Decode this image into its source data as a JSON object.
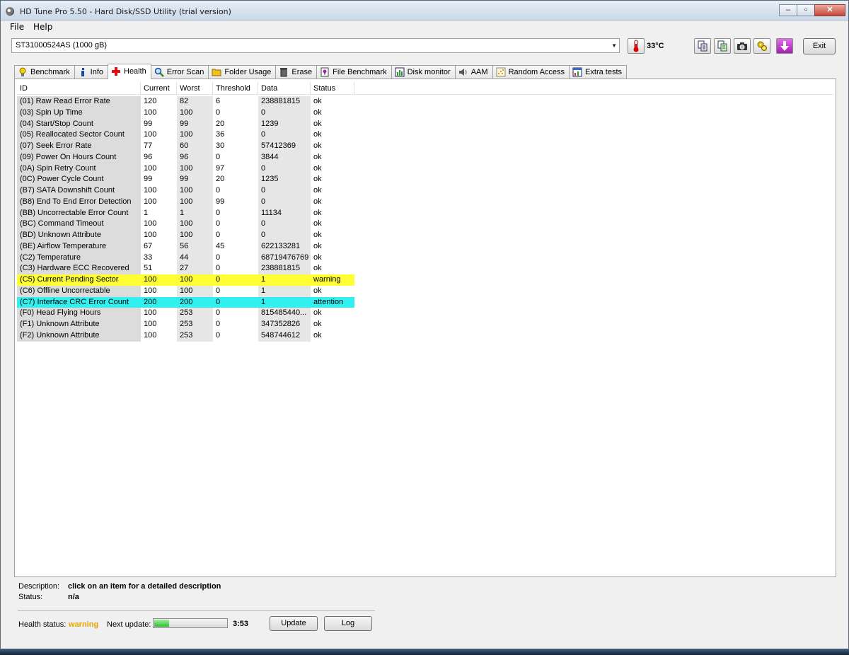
{
  "window": {
    "title": "HD Tune Pro 5.50 - Hard Disk/SSD Utility (trial version)"
  },
  "menu": {
    "file": "File",
    "help": "Help"
  },
  "toolbar": {
    "drive": "ST31000524AS (1000 gB)",
    "temperature": "33°C",
    "exit_label": "Exit",
    "icons": [
      "copy-text-icon",
      "copy-html-icon",
      "screenshot-icon",
      "options-icon",
      "save-icon"
    ]
  },
  "tabs": [
    {
      "label": "Benchmark",
      "icon": "lightbulb-icon"
    },
    {
      "label": "Info",
      "icon": "info-icon"
    },
    {
      "label": "Health",
      "icon": "cross-icon"
    },
    {
      "label": "Error Scan",
      "icon": "magnifier-icon"
    },
    {
      "label": "Folder Usage",
      "icon": "folder-icon"
    },
    {
      "label": "Erase",
      "icon": "trash-icon"
    },
    {
      "label": "File Benchmark",
      "icon": "file-bulb-icon"
    },
    {
      "label": "Disk monitor",
      "icon": "monitor-chart-icon"
    },
    {
      "label": "AAM",
      "icon": "speaker-icon"
    },
    {
      "label": "Random Access",
      "icon": "scatter-icon"
    },
    {
      "label": "Extra tests",
      "icon": "window-chart-icon"
    }
  ],
  "active_tab": "Health",
  "table": {
    "headers": {
      "id": "ID",
      "current": "Current",
      "worst": "Worst",
      "threshold": "Threshold",
      "data": "Data",
      "status": "Status"
    },
    "rows": [
      {
        "id": "(01) Raw Read Error Rate",
        "current": "120",
        "worst": "82",
        "threshold": "6",
        "data": "238881815",
        "status": "ok"
      },
      {
        "id": "(03) Spin Up Time",
        "current": "100",
        "worst": "100",
        "threshold": "0",
        "data": "0",
        "status": "ok"
      },
      {
        "id": "(04) Start/Stop Count",
        "current": "99",
        "worst": "99",
        "threshold": "20",
        "data": "1239",
        "status": "ok"
      },
      {
        "id": "(05) Reallocated Sector Count",
        "current": "100",
        "worst": "100",
        "threshold": "36",
        "data": "0",
        "status": "ok"
      },
      {
        "id": "(07) Seek Error Rate",
        "current": "77",
        "worst": "60",
        "threshold": "30",
        "data": "57412369",
        "status": "ok"
      },
      {
        "id": "(09) Power On Hours Count",
        "current": "96",
        "worst": "96",
        "threshold": "0",
        "data": "3844",
        "status": "ok"
      },
      {
        "id": "(0A) Spin Retry Count",
        "current": "100",
        "worst": "100",
        "threshold": "97",
        "data": "0",
        "status": "ok"
      },
      {
        "id": "(0C) Power Cycle Count",
        "current": "99",
        "worst": "99",
        "threshold": "20",
        "data": "1235",
        "status": "ok"
      },
      {
        "id": "(B7) SATA Downshift Count",
        "current": "100",
        "worst": "100",
        "threshold": "0",
        "data": "0",
        "status": "ok"
      },
      {
        "id": "(B8) End To End Error Detection",
        "current": "100",
        "worst": "100",
        "threshold": "99",
        "data": "0",
        "status": "ok"
      },
      {
        "id": "(BB) Uncorrectable Error Count",
        "current": "1",
        "worst": "1",
        "threshold": "0",
        "data": "11134",
        "status": "ok"
      },
      {
        "id": "(BC) Command Timeout",
        "current": "100",
        "worst": "100",
        "threshold": "0",
        "data": "0",
        "status": "ok"
      },
      {
        "id": "(BD) Unknown Attribute",
        "current": "100",
        "worst": "100",
        "threshold": "0",
        "data": "0",
        "status": "ok"
      },
      {
        "id": "(BE) Airflow Temperature",
        "current": "67",
        "worst": "56",
        "threshold": "45",
        "data": "622133281",
        "status": "ok"
      },
      {
        "id": "(C2) Temperature",
        "current": "33",
        "worst": "44",
        "threshold": "0",
        "data": "68719476769",
        "status": "ok"
      },
      {
        "id": "(C3) Hardware ECC Recovered",
        "current": "51",
        "worst": "27",
        "threshold": "0",
        "data": "238881815",
        "status": "ok"
      },
      {
        "id": "(C5) Current Pending Sector",
        "current": "100",
        "worst": "100",
        "threshold": "0",
        "data": "1",
        "status": "warning",
        "highlight": "#ffff33"
      },
      {
        "id": "(C6) Offline Uncorrectable",
        "current": "100",
        "worst": "100",
        "threshold": "0",
        "data": "1",
        "status": "ok"
      },
      {
        "id": "(C7) Interface CRC Error Count",
        "current": "200",
        "worst": "200",
        "threshold": "0",
        "data": "1",
        "status": "attention",
        "highlight": "#33f0f0"
      },
      {
        "id": "(F0) Head Flying Hours",
        "current": "100",
        "worst": "253",
        "threshold": "0",
        "data": "815485440...",
        "status": "ok"
      },
      {
        "id": "(F1) Unknown Attribute",
        "current": "100",
        "worst": "253",
        "threshold": "0",
        "data": "347352826",
        "status": "ok"
      },
      {
        "id": "(F2) Unknown Attribute",
        "current": "100",
        "worst": "253",
        "threshold": "0",
        "data": "548744612",
        "status": "ok"
      }
    ]
  },
  "details": {
    "description_label": "Description:",
    "description_value": "click on an item for a detailed description",
    "status_label": "Status:",
    "status_value": "n/a"
  },
  "footer": {
    "health_label": "Health status:",
    "health_value": "warning",
    "health_color": "#e8a400",
    "next_update_label": "Next update:",
    "progress_fraction": 0.2,
    "timer": "3:53",
    "update_label": "Update",
    "log_label": "Log"
  }
}
